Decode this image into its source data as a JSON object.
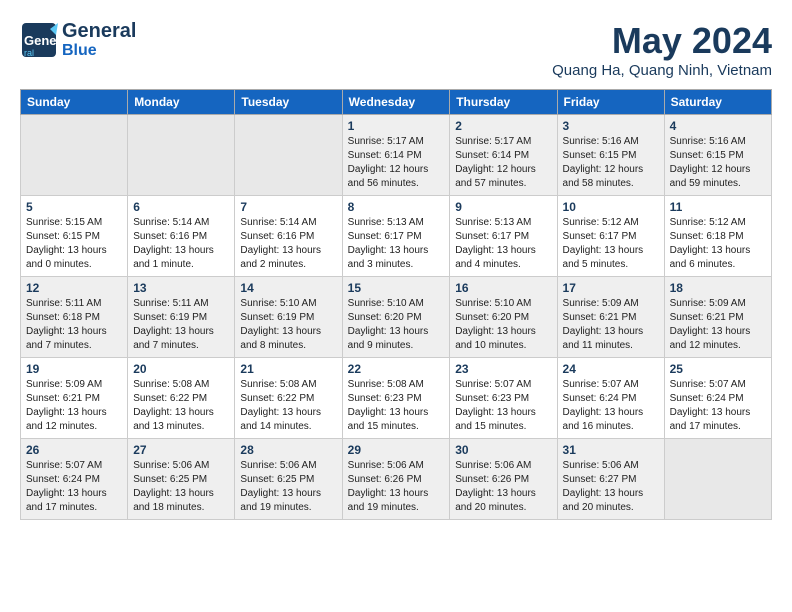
{
  "header": {
    "logo_line1": "General",
    "logo_line2": "Blue",
    "month": "May 2024",
    "location": "Quang Ha, Quang Ninh, Vietnam"
  },
  "weekdays": [
    "Sunday",
    "Monday",
    "Tuesday",
    "Wednesday",
    "Thursday",
    "Friday",
    "Saturday"
  ],
  "weeks": [
    [
      {
        "day": "",
        "info": ""
      },
      {
        "day": "",
        "info": ""
      },
      {
        "day": "",
        "info": ""
      },
      {
        "day": "1",
        "info": "Sunrise: 5:17 AM\nSunset: 6:14 PM\nDaylight: 12 hours and 56 minutes."
      },
      {
        "day": "2",
        "info": "Sunrise: 5:17 AM\nSunset: 6:14 PM\nDaylight: 12 hours and 57 minutes."
      },
      {
        "day": "3",
        "info": "Sunrise: 5:16 AM\nSunset: 6:15 PM\nDaylight: 12 hours and 58 minutes."
      },
      {
        "day": "4",
        "info": "Sunrise: 5:16 AM\nSunset: 6:15 PM\nDaylight: 12 hours and 59 minutes."
      }
    ],
    [
      {
        "day": "5",
        "info": "Sunrise: 5:15 AM\nSunset: 6:15 PM\nDaylight: 13 hours and 0 minutes."
      },
      {
        "day": "6",
        "info": "Sunrise: 5:14 AM\nSunset: 6:16 PM\nDaylight: 13 hours and 1 minute."
      },
      {
        "day": "7",
        "info": "Sunrise: 5:14 AM\nSunset: 6:16 PM\nDaylight: 13 hours and 2 minutes."
      },
      {
        "day": "8",
        "info": "Sunrise: 5:13 AM\nSunset: 6:17 PM\nDaylight: 13 hours and 3 minutes."
      },
      {
        "day": "9",
        "info": "Sunrise: 5:13 AM\nSunset: 6:17 PM\nDaylight: 13 hours and 4 minutes."
      },
      {
        "day": "10",
        "info": "Sunrise: 5:12 AM\nSunset: 6:17 PM\nDaylight: 13 hours and 5 minutes."
      },
      {
        "day": "11",
        "info": "Sunrise: 5:12 AM\nSunset: 6:18 PM\nDaylight: 13 hours and 6 minutes."
      }
    ],
    [
      {
        "day": "12",
        "info": "Sunrise: 5:11 AM\nSunset: 6:18 PM\nDaylight: 13 hours and 7 minutes."
      },
      {
        "day": "13",
        "info": "Sunrise: 5:11 AM\nSunset: 6:19 PM\nDaylight: 13 hours and 7 minutes."
      },
      {
        "day": "14",
        "info": "Sunrise: 5:10 AM\nSunset: 6:19 PM\nDaylight: 13 hours and 8 minutes."
      },
      {
        "day": "15",
        "info": "Sunrise: 5:10 AM\nSunset: 6:20 PM\nDaylight: 13 hours and 9 minutes."
      },
      {
        "day": "16",
        "info": "Sunrise: 5:10 AM\nSunset: 6:20 PM\nDaylight: 13 hours and 10 minutes."
      },
      {
        "day": "17",
        "info": "Sunrise: 5:09 AM\nSunset: 6:21 PM\nDaylight: 13 hours and 11 minutes."
      },
      {
        "day": "18",
        "info": "Sunrise: 5:09 AM\nSunset: 6:21 PM\nDaylight: 13 hours and 12 minutes."
      }
    ],
    [
      {
        "day": "19",
        "info": "Sunrise: 5:09 AM\nSunset: 6:21 PM\nDaylight: 13 hours and 12 minutes."
      },
      {
        "day": "20",
        "info": "Sunrise: 5:08 AM\nSunset: 6:22 PM\nDaylight: 13 hours and 13 minutes."
      },
      {
        "day": "21",
        "info": "Sunrise: 5:08 AM\nSunset: 6:22 PM\nDaylight: 13 hours and 14 minutes."
      },
      {
        "day": "22",
        "info": "Sunrise: 5:08 AM\nSunset: 6:23 PM\nDaylight: 13 hours and 15 minutes."
      },
      {
        "day": "23",
        "info": "Sunrise: 5:07 AM\nSunset: 6:23 PM\nDaylight: 13 hours and 15 minutes."
      },
      {
        "day": "24",
        "info": "Sunrise: 5:07 AM\nSunset: 6:24 PM\nDaylight: 13 hours and 16 minutes."
      },
      {
        "day": "25",
        "info": "Sunrise: 5:07 AM\nSunset: 6:24 PM\nDaylight: 13 hours and 17 minutes."
      }
    ],
    [
      {
        "day": "26",
        "info": "Sunrise: 5:07 AM\nSunset: 6:24 PM\nDaylight: 13 hours and 17 minutes."
      },
      {
        "day": "27",
        "info": "Sunrise: 5:06 AM\nSunset: 6:25 PM\nDaylight: 13 hours and 18 minutes."
      },
      {
        "day": "28",
        "info": "Sunrise: 5:06 AM\nSunset: 6:25 PM\nDaylight: 13 hours and 19 minutes."
      },
      {
        "day": "29",
        "info": "Sunrise: 5:06 AM\nSunset: 6:26 PM\nDaylight: 13 hours and 19 minutes."
      },
      {
        "day": "30",
        "info": "Sunrise: 5:06 AM\nSunset: 6:26 PM\nDaylight: 13 hours and 20 minutes."
      },
      {
        "day": "31",
        "info": "Sunrise: 5:06 AM\nSunset: 6:27 PM\nDaylight: 13 hours and 20 minutes."
      },
      {
        "day": "",
        "info": ""
      }
    ]
  ]
}
